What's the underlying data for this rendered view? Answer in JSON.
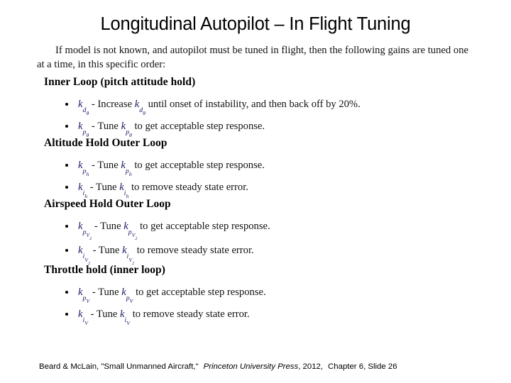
{
  "slide": {
    "title": "Longitudinal Autopilot – In Flight Tuning",
    "intro": "If model is not known, and autopilot must be tuned in flight, then the following gains are tuned one at a time, in this specific order:",
    "sections": [
      {
        "heading": "Inner Loop (pitch attitude hold)",
        "items": [
          {
            "gain_base": "k",
            "gain_sub": "d",
            "gain_sub_sub": "θ",
            "separator": "-",
            "text_before": "Increase",
            "text_after": "until onset of instability, and then back off by 20%."
          },
          {
            "gain_base": "k",
            "gain_sub": "p",
            "gain_sub_sub": "θ",
            "separator": "-",
            "text_before": "Tune",
            "text_after": "to get acceptable step response."
          }
        ]
      },
      {
        "heading": "Altitude Hold Outer Loop",
        "items": [
          {
            "gain_base": "k",
            "gain_sub": "p",
            "gain_sub_sub": "h",
            "separator": "-",
            "text_before": "Tune",
            "text_after": "to get acceptable step response."
          },
          {
            "gain_base": "k",
            "gain_sub": "i",
            "gain_sub_sub": "h",
            "separator": "-",
            "text_before": "Tune",
            "text_after": "to remove steady state error."
          }
        ]
      },
      {
        "heading": "Airspeed Hold Outer Loop",
        "items": [
          {
            "gain_base": "k",
            "gain_sub": "p",
            "gain_sub_sub": "V",
            "gain_sub_sub_sub": "2",
            "separator": "-",
            "text_before": "Tune",
            "text_after": "to get acceptable step response."
          },
          {
            "gain_base": "k",
            "gain_sub": "i",
            "gain_sub_sub": "V",
            "gain_sub_sub_sub": "2",
            "separator": "-",
            "text_before": "Tune",
            "text_after": "to remove steady state error."
          }
        ]
      },
      {
        "heading": "Throttle hold (inner loop)",
        "items": [
          {
            "gain_base": "k",
            "gain_sub": "p",
            "gain_sub_sub": "V",
            "separator": "-",
            "text_before": "Tune",
            "text_after": "to get acceptable step response."
          },
          {
            "gain_base": "k",
            "gain_sub": "i",
            "gain_sub_sub": "V",
            "separator": "-",
            "text_before": "Tune",
            "text_after": "to remove steady state error."
          }
        ]
      }
    ]
  },
  "footer": {
    "authors": "Beard & Mc",
    "authors_cont": "Lain, ",
    "book": "\"Small Unmanned Aircraft,\"",
    "publisher": "Princeton University Press",
    "year": ", 2012,",
    "location": "Chapter 6, Slide 26"
  },
  "colors": {
    "math": "#1f1f6e",
    "text": "#1a1a1a",
    "background": "#ffffff"
  }
}
